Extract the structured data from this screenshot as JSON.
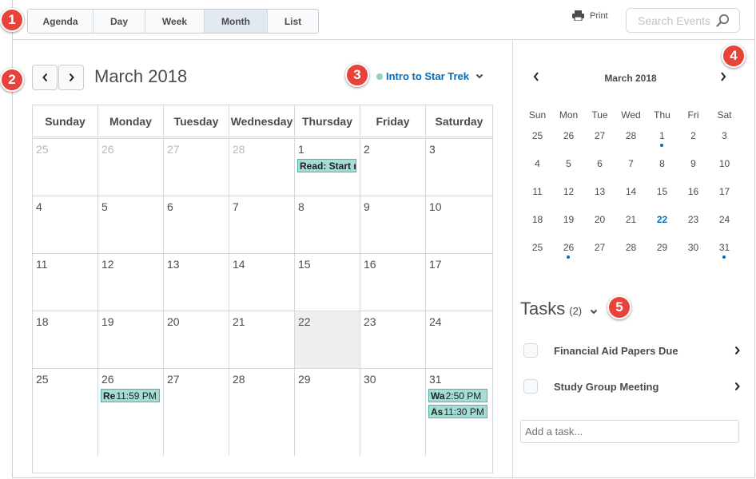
{
  "view_tabs": [
    {
      "label": "Agenda",
      "active": false
    },
    {
      "label": "Day",
      "active": false
    },
    {
      "label": "Week",
      "active": false
    },
    {
      "label": "Month",
      "active": true
    },
    {
      "label": "List",
      "active": false
    }
  ],
  "print_label": "Print",
  "search": {
    "placeholder": "Search Events"
  },
  "calendar": {
    "title": "March 2018",
    "selected_calendar": "Intro to Star Trek",
    "weekdays": [
      "Sunday",
      "Monday",
      "Tuesday",
      "Wednesday",
      "Thursday",
      "Friday",
      "Saturday"
    ],
    "weeks": [
      [
        {
          "d": "25",
          "other": true
        },
        {
          "d": "26",
          "other": true
        },
        {
          "d": "27",
          "other": true
        },
        {
          "d": "28",
          "other": true
        },
        {
          "d": "1",
          "events": [
            {
              "title": "Read: Start r",
              "time": ""
            }
          ]
        },
        {
          "d": "2"
        },
        {
          "d": "3"
        }
      ],
      [
        {
          "d": "4"
        },
        {
          "d": "5"
        },
        {
          "d": "6"
        },
        {
          "d": "7"
        },
        {
          "d": "8"
        },
        {
          "d": "9"
        },
        {
          "d": "10"
        }
      ],
      [
        {
          "d": "11"
        },
        {
          "d": "12"
        },
        {
          "d": "13"
        },
        {
          "d": "14"
        },
        {
          "d": "15"
        },
        {
          "d": "16"
        },
        {
          "d": "17"
        }
      ],
      [
        {
          "d": "18"
        },
        {
          "d": "19"
        },
        {
          "d": "20"
        },
        {
          "d": "21"
        },
        {
          "d": "22",
          "today": true
        },
        {
          "d": "23"
        },
        {
          "d": "24"
        }
      ],
      [
        {
          "d": "25"
        },
        {
          "d": "26",
          "events": [
            {
              "title": "Re",
              "time": "11:59 PM"
            }
          ]
        },
        {
          "d": "27"
        },
        {
          "d": "28"
        },
        {
          "d": "29"
        },
        {
          "d": "30"
        },
        {
          "d": "31",
          "events": [
            {
              "title": "Wa",
              "time": "2:50 PM"
            },
            {
              "title": "As",
              "time": "11:30 PM"
            }
          ]
        }
      ]
    ]
  },
  "mini_calendar": {
    "title": "March 2018",
    "weekdays": [
      "Sun",
      "Mon",
      "Tue",
      "Wed",
      "Thu",
      "Fri",
      "Sat"
    ],
    "weeks": [
      [
        {
          "d": "25"
        },
        {
          "d": "26"
        },
        {
          "d": "27"
        },
        {
          "d": "28"
        },
        {
          "d": "1",
          "dot": true
        },
        {
          "d": "2"
        },
        {
          "d": "3"
        }
      ],
      [
        {
          "d": "4"
        },
        {
          "d": "5"
        },
        {
          "d": "6"
        },
        {
          "d": "7"
        },
        {
          "d": "8"
        },
        {
          "d": "9"
        },
        {
          "d": "10"
        }
      ],
      [
        {
          "d": "11"
        },
        {
          "d": "12"
        },
        {
          "d": "13"
        },
        {
          "d": "14"
        },
        {
          "d": "15"
        },
        {
          "d": "16"
        },
        {
          "d": "17"
        }
      ],
      [
        {
          "d": "18"
        },
        {
          "d": "19"
        },
        {
          "d": "20"
        },
        {
          "d": "21"
        },
        {
          "d": "22",
          "today": true
        },
        {
          "d": "23"
        },
        {
          "d": "24"
        }
      ],
      [
        {
          "d": "25"
        },
        {
          "d": "26",
          "dot": true
        },
        {
          "d": "27"
        },
        {
          "d": "28"
        },
        {
          "d": "29"
        },
        {
          "d": "30"
        },
        {
          "d": "31",
          "dot": true
        }
      ]
    ]
  },
  "tasks": {
    "title": "Tasks",
    "count": "(2)",
    "items": [
      "Financial Aid Papers Due",
      "Study Group Meeting"
    ],
    "add_placeholder": "Add a task..."
  },
  "callouts": [
    "1",
    "2",
    "3",
    "4",
    "5"
  ],
  "colors": {
    "accent": "#006fbf",
    "event_fill": "#a4ddd6",
    "event_border": "#4bb5a8",
    "callout": "#e8423a"
  }
}
